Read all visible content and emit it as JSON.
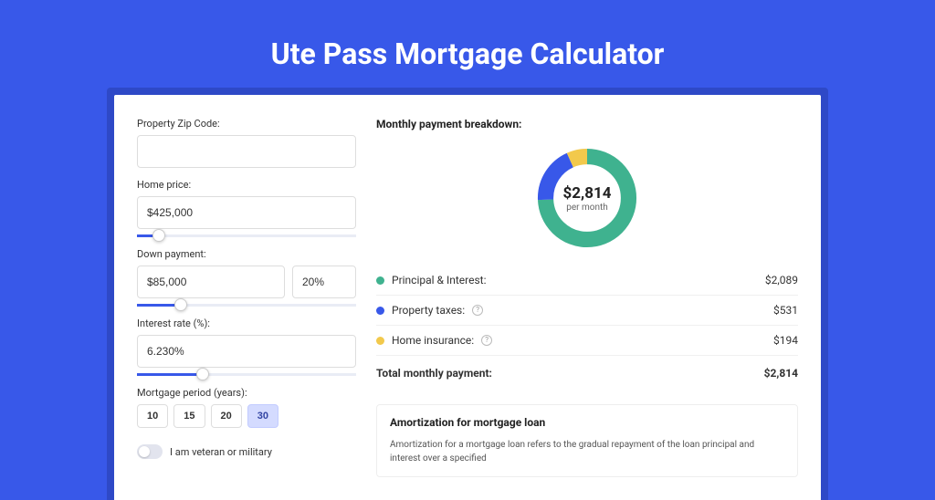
{
  "hero": {
    "title": "Ute Pass Mortgage Calculator"
  },
  "form": {
    "zip_label": "Property Zip Code:",
    "zip_value": "",
    "home_price_label": "Home price:",
    "home_price_value": "$425,000",
    "home_price_pct": 10,
    "down_payment_label": "Down payment:",
    "down_payment_value": "$85,000",
    "down_payment_pct_value": "20%",
    "down_payment_pct": 20,
    "interest_label": "Interest rate (%):",
    "interest_value": "6.230%",
    "interest_pct": 30,
    "period_label": "Mortgage period (years):",
    "periods": [
      "10",
      "15",
      "20",
      "30"
    ],
    "period_active_index": 3,
    "veteran_label": "I am veteran or military"
  },
  "breakdown": {
    "title": "Monthly payment breakdown:",
    "donut_amount": "$2,814",
    "donut_sub": "per month",
    "rows": [
      {
        "label": "Principal & Interest:",
        "amount": "$2,089",
        "color": "#3fb28f"
      },
      {
        "label": "Property taxes:",
        "amount": "$531",
        "color": "#3858e9",
        "has_info": true
      },
      {
        "label": "Home insurance:",
        "amount": "$194",
        "color": "#f2c94c",
        "has_info": true
      }
    ],
    "total_label": "Total monthly payment:",
    "total_amount": "$2,814"
  },
  "chart_data": {
    "type": "pie",
    "title": "Monthly payment breakdown",
    "series": [
      {
        "name": "Principal & Interest",
        "value": 2089,
        "color": "#3fb28f"
      },
      {
        "name": "Property taxes",
        "value": 531,
        "color": "#3858e9"
      },
      {
        "name": "Home insurance",
        "value": 194,
        "color": "#f2c94c"
      }
    ],
    "total": 2814,
    "center_label": "$2,814",
    "center_sub": "per month"
  },
  "amort": {
    "title": "Amortization for mortgage loan",
    "text": "Amortization for a mortgage loan refers to the gradual repayment of the loan principal and interest over a specified"
  }
}
